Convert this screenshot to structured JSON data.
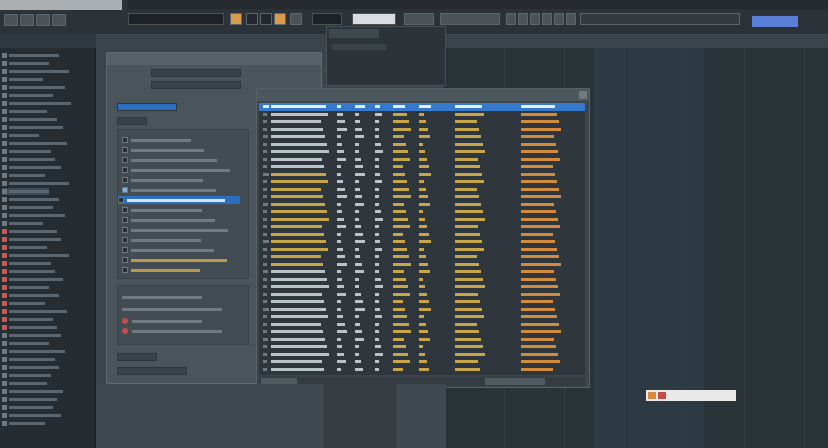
{
  "colors": {
    "background": "#3a4249",
    "panel": "#4a545b",
    "selection": "#3479cc",
    "accent_orange": "#d99a4c",
    "accent_blue": "#5a7fd6",
    "text": "#aeb8bf"
  },
  "icons": {
    "sidebar_item": "folder-icon",
    "record": "record-icon",
    "close": "close-icon"
  },
  "toolbar": {
    "window_title": "",
    "tag_label": ""
  },
  "sidebar": {
    "header": ""
  },
  "dialog": {
    "title": "",
    "field_1": "",
    "field_2": ""
  },
  "table_window": {
    "title": ""
  },
  "badge": {
    "label": ""
  }
}
